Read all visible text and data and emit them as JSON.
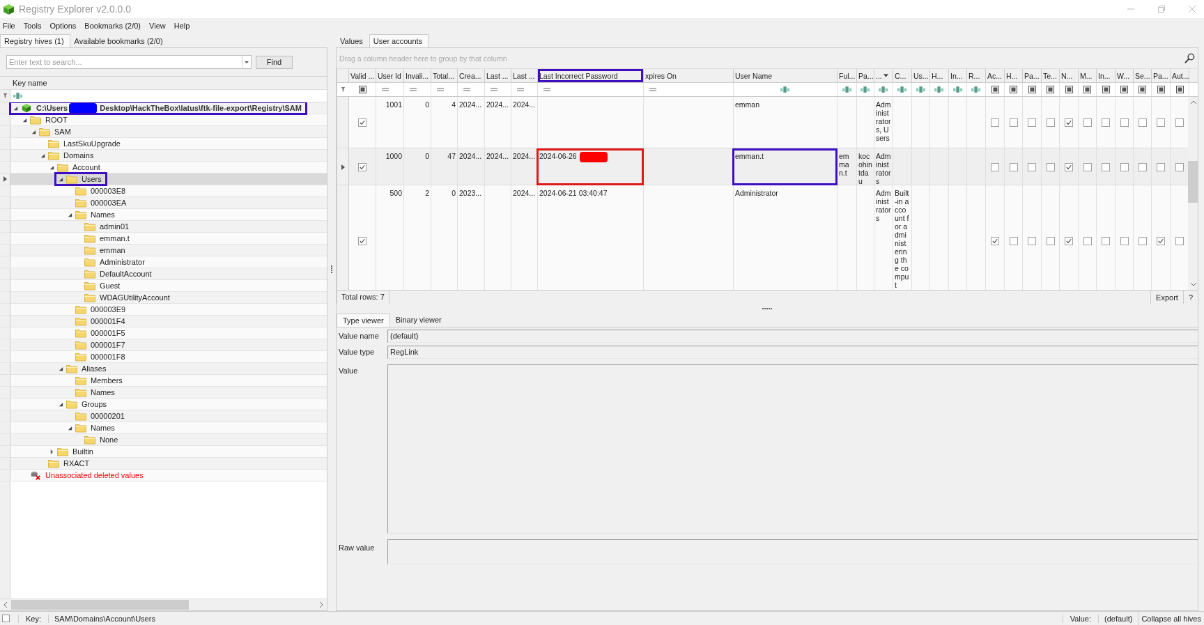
{
  "window": {
    "title": "Registry Explorer v2.0.0.0"
  },
  "menu": [
    "File",
    "Tools",
    "Options",
    "Bookmarks (2/0)",
    "View",
    "Help"
  ],
  "left_tabs": [
    {
      "label": "Registry hives (1)",
      "selected": true
    },
    {
      "label": "Available bookmarks (2/0)",
      "selected": false
    }
  ],
  "search": {
    "placeholder": "Enter text to search...",
    "button": "Find"
  },
  "tree_header": "Key name",
  "tree": [
    {
      "kind": "hive",
      "label": "C:\\Users",
      "label_after": "Desktop\\HackTheBox\\latus\\ftk-file-export\\Registry\\SAM",
      "redaction": {
        "color": "#0000ff"
      },
      "annotation": {
        "color": "#3d0fc0"
      },
      "expanded": true,
      "selected": false,
      "children": [
        {
          "kind": "folder",
          "label": "ROOT",
          "expanded": true,
          "selected": false,
          "children": [
            {
              "kind": "folder",
              "label": "SAM",
              "expanded": true,
              "selected": false,
              "children": [
                {
                  "kind": "folder",
                  "label": "LastSkuUpgrade",
                  "selected": false
                },
                {
                  "kind": "folder",
                  "label": "Domains",
                  "expanded": true,
                  "selected": false,
                  "children": [
                    {
                      "kind": "folder",
                      "label": "Account",
                      "expanded": true,
                      "selected": false,
                      "children": [
                        {
                          "kind": "folder",
                          "label": "Users",
                          "expanded": true,
                          "selected": true,
                          "annotation": {
                            "color": "#3d0fc0"
                          },
                          "children": [
                            {
                              "kind": "folder",
                              "label": "000003E8",
                              "selected": false
                            },
                            {
                              "kind": "folder",
                              "label": "000003EA",
                              "selected": false
                            },
                            {
                              "kind": "folder",
                              "label": "Names",
                              "expanded": true,
                              "selected": false,
                              "children": [
                                {
                                  "kind": "folder",
                                  "label": "admin01",
                                  "selected": false
                                },
                                {
                                  "kind": "folder",
                                  "label": "emman.t",
                                  "selected": false
                                },
                                {
                                  "kind": "folder",
                                  "label": "emman",
                                  "selected": false
                                },
                                {
                                  "kind": "folder",
                                  "label": "Administrator",
                                  "selected": false
                                },
                                {
                                  "kind": "folder",
                                  "label": "DefaultAccount",
                                  "selected": false
                                },
                                {
                                  "kind": "folder",
                                  "label": "Guest",
                                  "selected": false
                                },
                                {
                                  "kind": "folder",
                                  "label": "WDAGUtilityAccount",
                                  "selected": false
                                }
                              ]
                            },
                            {
                              "kind": "folder",
                              "label": "000003E9",
                              "selected": false
                            },
                            {
                              "kind": "folder",
                              "label": "000001F4",
                              "selected": false
                            },
                            {
                              "kind": "folder",
                              "label": "000001F5",
                              "selected": false
                            },
                            {
                              "kind": "folder",
                              "label": "000001F7",
                              "selected": false
                            },
                            {
                              "kind": "folder",
                              "label": "000001F8",
                              "selected": false
                            }
                          ]
                        },
                        {
                          "kind": "folder",
                          "label": "Aliases",
                          "expanded": true,
                          "selected": false,
                          "children": [
                            {
                              "kind": "folder",
                              "label": "Members",
                              "selected": false
                            },
                            {
                              "kind": "folder",
                              "label": "Names",
                              "selected": false
                            }
                          ]
                        },
                        {
                          "kind": "folder",
                          "label": "Groups",
                          "expanded": true,
                          "selected": false,
                          "children": [
                            {
                              "kind": "folder",
                              "label": "00000201",
                              "selected": false
                            },
                            {
                              "kind": "folder",
                              "label": "Names",
                              "expanded": true,
                              "selected": false,
                              "children": [
                                {
                                  "kind": "folder",
                                  "label": "None",
                                  "selected": false
                                }
                              ]
                            }
                          ]
                        }
                      ]
                    },
                    {
                      "kind": "folder",
                      "label": "Builtin",
                      "expanded": false,
                      "selected": false
                    }
                  ]
                },
                {
                  "kind": "folder",
                  "label": "RXACT",
                  "selected": false
                }
              ]
            }
          ]
        },
        {
          "kind": "deleted",
          "label": "Unassociated deleted values",
          "selected": false
        }
      ]
    }
  ],
  "right_tabs": [
    {
      "label": "Values",
      "selected": false
    },
    {
      "label": "User accounts",
      "selected": true
    }
  ],
  "group_panel": "Drag a column header here to group by that column",
  "columns": [
    {
      "label": "Valid ...",
      "kind": "bool"
    },
    {
      "label": "User Id",
      "kind": "number"
    },
    {
      "label": "Invali...",
      "kind": "number"
    },
    {
      "label": "Total...",
      "kind": "number"
    },
    {
      "label": "Crea...",
      "kind": "date"
    },
    {
      "label": "Last ...",
      "kind": "date"
    },
    {
      "label": "Last ...",
      "kind": "date"
    },
    {
      "label": "Last Incorrect Password",
      "kind": "date",
      "annotation": {
        "color": "#3d0fc0"
      }
    },
    {
      "label": "xpires On",
      "kind": "date"
    },
    {
      "label": "User Name",
      "kind": "text"
    },
    {
      "label": "Ful...",
      "kind": "text"
    },
    {
      "label": "Pa...",
      "kind": "text"
    },
    {
      "label": "...",
      "kind": "text",
      "menu": true
    },
    {
      "label": "C...",
      "kind": "text"
    },
    {
      "label": "Us...",
      "kind": "text"
    },
    {
      "label": "H...",
      "kind": "text"
    },
    {
      "label": "In...",
      "kind": "text"
    },
    {
      "label": "R...",
      "kind": "text"
    },
    {
      "label": "Ac...",
      "kind": "bool"
    },
    {
      "label": "H...",
      "kind": "bool"
    },
    {
      "label": "Pa...",
      "kind": "bool"
    },
    {
      "label": "Te...",
      "kind": "bool"
    },
    {
      "label": "N...",
      "kind": "bool"
    },
    {
      "label": "M...",
      "kind": "bool"
    },
    {
      "label": "In...",
      "kind": "bool"
    },
    {
      "label": "W...",
      "kind": "bool"
    },
    {
      "label": "Se...",
      "kind": "bool"
    },
    {
      "label": "Pa...",
      "kind": "bool"
    },
    {
      "label": "Aut...",
      "kind": "bool"
    }
  ],
  "rows": [
    {
      "selected": false,
      "cells": [
        true,
        "1001",
        "0",
        "4",
        "2024...",
        "2024...",
        "2024...",
        null,
        null,
        "emman",
        null,
        null,
        "Administrators, Users",
        null,
        null,
        null,
        null,
        null,
        false,
        false,
        false,
        false,
        true,
        false,
        false,
        false,
        false,
        false,
        false
      ]
    },
    {
      "selected": true,
      "cells": [
        true,
        "1000",
        "0",
        "47",
        "2024...",
        "2024...",
        "2024...",
        {
          "text": "2024-06-26",
          "redaction": {
            "color": "#ff0000"
          },
          "annotation": {
            "color": "#e01818"
          }
        },
        null,
        {
          "text": "emman.t",
          "annotation": {
            "color": "#3d0fc0"
          }
        },
        "emman.t",
        "kocohintdau",
        "Administrators",
        null,
        null,
        null,
        null,
        null,
        false,
        false,
        false,
        false,
        true,
        false,
        false,
        false,
        false,
        false,
        false
      ]
    },
    {
      "selected": false,
      "cells": [
        true,
        "500",
        "2",
        "0",
        "2023...",
        null,
        "2024...",
        "2024-06-21 03:40:47",
        null,
        "Administrator",
        null,
        null,
        "Administrators",
        "Built-in account for administering the comput",
        null,
        null,
        null,
        null,
        true,
        false,
        false,
        false,
        true,
        false,
        false,
        false,
        false,
        true,
        false
      ]
    }
  ],
  "footer": {
    "total": "Total rows: 7",
    "export": "Export",
    "help": "?"
  },
  "viewer_tabs": [
    {
      "label": "Type viewer",
      "selected": true
    },
    {
      "label": "Binary viewer",
      "selected": false
    }
  ],
  "viewer_fields": [
    {
      "kind": "line",
      "label": "Value name",
      "value": "(default)"
    },
    {
      "kind": "line",
      "label": "Value type",
      "value": "RegLink"
    },
    {
      "kind": "area",
      "label": "Value"
    },
    {
      "kind": "raw",
      "label": "Raw value"
    }
  ],
  "status_bar": {
    "checked": false,
    "key_label": "Key:",
    "key": "SAM\\Domains\\Account\\Users",
    "value_label": "Value:",
    "value": "(default)",
    "collapse": "Collapse all hives"
  }
}
